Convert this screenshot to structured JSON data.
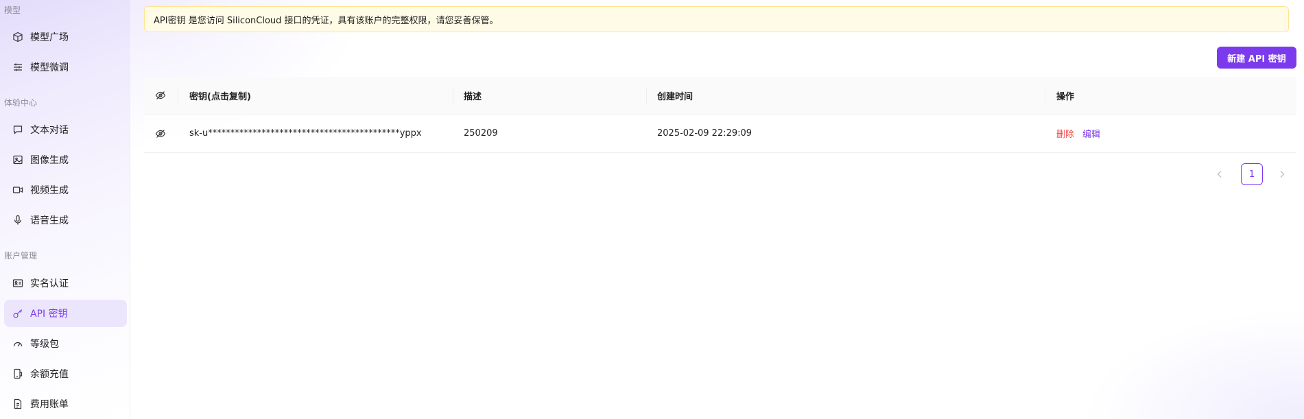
{
  "sidebar": {
    "sections": [
      {
        "title": "模型"
      },
      {
        "title": "体验中心"
      },
      {
        "title": "账户管理"
      }
    ],
    "items": [
      {
        "label": "模型广场",
        "icon": "cube-icon"
      },
      {
        "label": "模型微调",
        "icon": "sliders-icon"
      },
      {
        "label": "文本对话",
        "icon": "chat-icon"
      },
      {
        "label": "图像生成",
        "icon": "image-icon"
      },
      {
        "label": "视频生成",
        "icon": "video-icon"
      },
      {
        "label": "语音生成",
        "icon": "microphone-icon"
      },
      {
        "label": "实名认证",
        "icon": "id-card-icon"
      },
      {
        "label": "API 密钥",
        "icon": "key-icon",
        "active": true
      },
      {
        "label": "等级包",
        "icon": "gauge-icon"
      },
      {
        "label": "余额充值",
        "icon": "wallet-icon"
      },
      {
        "label": "费用账单",
        "icon": "bill-icon"
      }
    ]
  },
  "notice": {
    "text": "API密钥 是您访问 SiliconCloud 接口的凭证，具有该账户的完整权限，请您妥善保管。"
  },
  "toolbar": {
    "new_key_label": "新建 API 密钥"
  },
  "table": {
    "columns": [
      "密钥(点击复制)",
      "描述",
      "创建时间",
      "操作"
    ],
    "rows": [
      {
        "key": "sk-u*******************************************yppx",
        "description": "250209",
        "created": "2025-02-09 22:29:09",
        "delete_label": "删除",
        "edit_label": "编辑"
      }
    ]
  },
  "pagination": {
    "current_page": "1"
  },
  "colors": {
    "accent": "#7c3aed",
    "danger": "#f5484a",
    "notice_bg": "#fffbe6",
    "notice_border": "#ffe58f"
  }
}
